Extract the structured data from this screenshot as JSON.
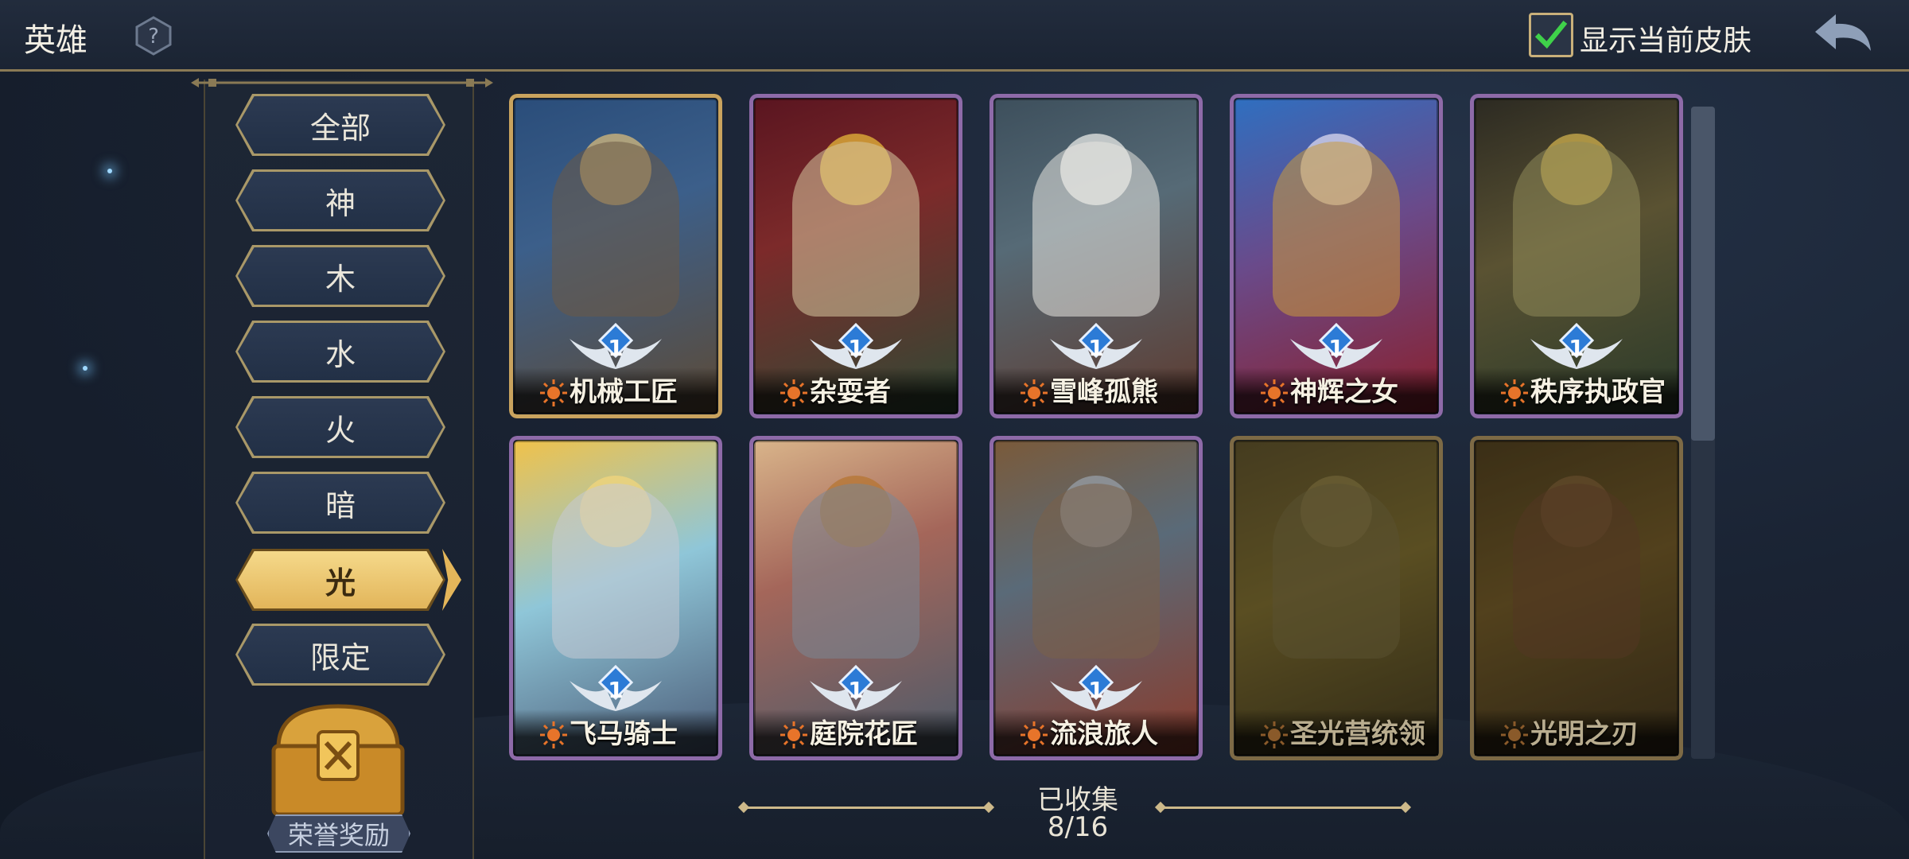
{
  "header": {
    "title": "英雄",
    "help_icon": "question-icon",
    "show_skin_label": "显示当前皮肤",
    "show_skin_checked": true,
    "back_icon": "back-arrow-icon"
  },
  "sidebar": {
    "categories": [
      {
        "label": "全部",
        "active": false
      },
      {
        "label": "神",
        "active": false
      },
      {
        "label": "木",
        "active": false
      },
      {
        "label": "水",
        "active": false
      },
      {
        "label": "火",
        "active": false
      },
      {
        "label": "暗",
        "active": false
      },
      {
        "label": "光",
        "active": true
      },
      {
        "label": "限定",
        "active": false
      }
    ],
    "reward": {
      "label": "荣誉奖励",
      "icon": "treasure-chest-icon"
    }
  },
  "heroes": [
    {
      "name": "机械工匠",
      "level": "1",
      "owned": true,
      "frame": "#c9a35e"
    },
    {
      "name": "杂耍者",
      "level": "1",
      "owned": true,
      "frame": "#8e6aa8"
    },
    {
      "name": "雪峰孤熊",
      "level": "1",
      "owned": true,
      "frame": "#8e6aa8"
    },
    {
      "name": "神辉之女",
      "level": "1",
      "owned": true,
      "frame": "#8e6aa8"
    },
    {
      "name": "秩序执政官",
      "level": "1",
      "owned": true,
      "frame": "#8e6aa8"
    },
    {
      "name": "飞马骑士",
      "level": "1",
      "owned": true,
      "frame": "#8e6aa8"
    },
    {
      "name": "庭院花匠",
      "level": "1",
      "owned": true,
      "frame": "#8e6aa8"
    },
    {
      "name": "流浪旅人",
      "level": "1",
      "owned": true,
      "frame": "#8e6aa8"
    },
    {
      "name": "圣光营统领",
      "level": "",
      "owned": false,
      "frame": "#7d6a45"
    },
    {
      "name": "光明之刃",
      "level": "",
      "owned": false,
      "frame": "#7d6a45"
    }
  ],
  "collection": {
    "label": "已收集",
    "count": "8/16"
  }
}
